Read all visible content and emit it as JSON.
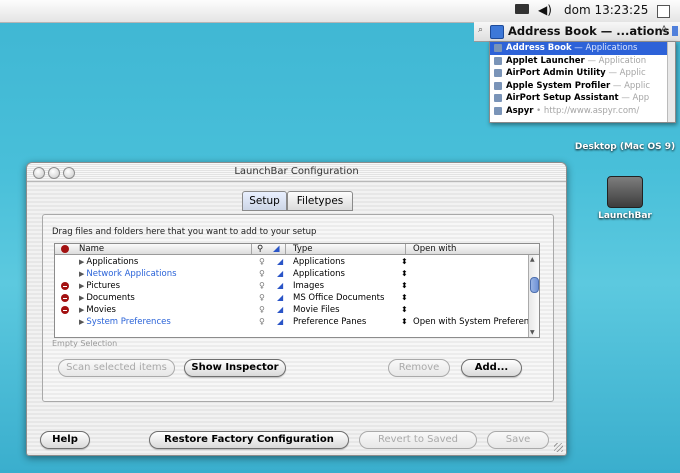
{
  "menubar": {
    "display_icon": "display-icon",
    "volume_icon": "speaker-icon",
    "clock": "dom 13:23:25",
    "menu_icon": "document-icon"
  },
  "launchbar": {
    "title": "Address Book — ...ations",
    "items": [
      {
        "name": "Address Book",
        "sub": "— Applications",
        "selected": true
      },
      {
        "name": "Applet Launcher",
        "sub": "— Application",
        "selected": false
      },
      {
        "name": "AirPort Admin Utility",
        "sub": "— Applic",
        "selected": false
      },
      {
        "name": "Apple System Profiler",
        "sub": "— Applic",
        "selected": false
      },
      {
        "name": "AirPort Setup Assistant",
        "sub": "— App",
        "selected": false
      },
      {
        "name": "Aspyr",
        "sub": "• http://www.aspyr.com/",
        "selected": false
      }
    ]
  },
  "desktop": {
    "icon1": "Desktop (Mac OS 9)",
    "icon2": "LaunchBar"
  },
  "window": {
    "title": "LaunchBar Configuration",
    "tabs": [
      "Setup",
      "Filetypes"
    ],
    "hint": "Drag files and folders here that you want to add to your setup",
    "columns": {
      "name": "Name",
      "type": "Type",
      "open_with": "Open with"
    },
    "rows": [
      {
        "name": "Applications",
        "type": "Applications",
        "open_with": "",
        "removable": false,
        "link": false
      },
      {
        "name": "Network Applications",
        "type": "Applications",
        "open_with": "",
        "removable": false,
        "link": true
      },
      {
        "name": "Pictures",
        "type": "Images",
        "open_with": "",
        "removable": true,
        "link": false
      },
      {
        "name": "Documents",
        "type": "MS Office Documents",
        "open_with": "",
        "removable": true,
        "link": false
      },
      {
        "name": "Movies",
        "type": "Movie Files",
        "open_with": "",
        "removable": true,
        "link": false
      },
      {
        "name": "System Preferences",
        "type": "Preference Panes",
        "open_with": "Open with System Preferen",
        "removable": false,
        "link": true
      }
    ],
    "empty_selection": "Empty Selection",
    "buttons": {
      "scan": "Scan selected items",
      "inspector": "Show Inspector",
      "remove": "Remove",
      "add": "Add...",
      "help": "Help",
      "restore": "Restore Factory Configuration",
      "revert": "Revert to Saved",
      "save": "Save"
    }
  }
}
